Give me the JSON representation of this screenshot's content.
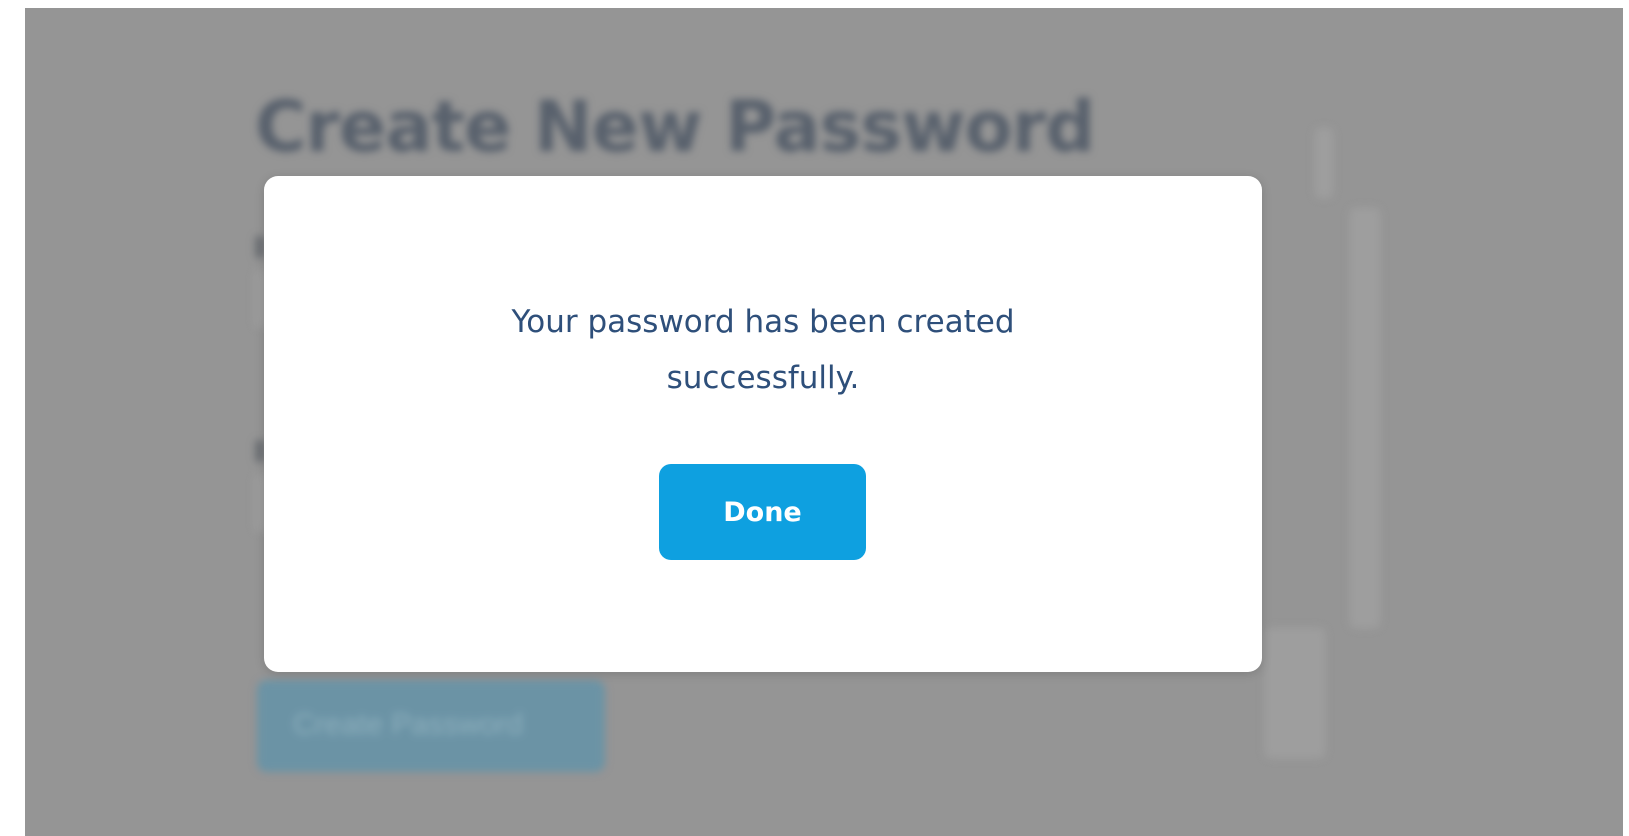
{
  "background_page": {
    "title": "Create New Password",
    "submit_label": "Create Password"
  },
  "modal": {
    "message_line1": "Your password has been created",
    "message_line2": "successfully.",
    "done_label": "Done"
  },
  "colors": {
    "accent": "#0ea0e0",
    "message_text": "#2e4f7a",
    "overlay": "#9a9a9a"
  }
}
